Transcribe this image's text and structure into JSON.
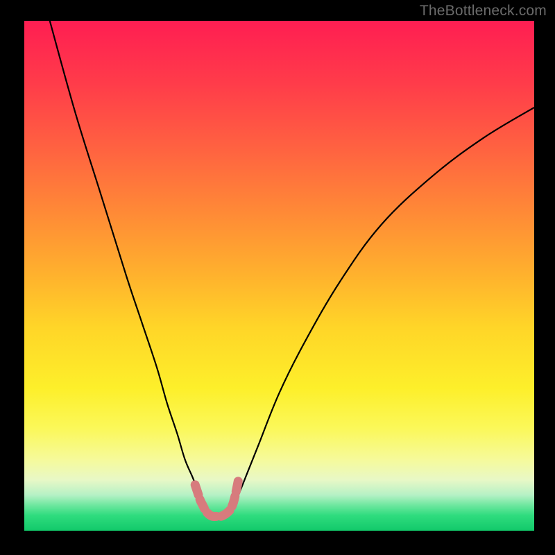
{
  "watermark": "TheBottleneck.com",
  "chart_data": {
    "type": "line",
    "title": "",
    "xlabel": "",
    "ylabel": "",
    "xlim": [
      0,
      100
    ],
    "ylim": [
      0,
      100
    ],
    "series": [
      {
        "name": "left-curve",
        "x": [
          5,
          10,
          15,
          20,
          23,
          26,
          28,
          30,
          31.5,
          33,
          34,
          35,
          36.5
        ],
        "values": [
          100,
          82,
          66,
          50,
          41,
          32,
          25,
          19,
          14,
          10.5,
          8,
          6,
          3.5
        ]
      },
      {
        "name": "right-curve",
        "x": [
          40.5,
          42,
          44,
          46,
          50,
          55,
          62,
          70,
          80,
          90,
          100
        ],
        "values": [
          3.5,
          7,
          12,
          17,
          27,
          37,
          49,
          60,
          69.5,
          77,
          83
        ]
      },
      {
        "name": "valley-marker",
        "x": [
          33.5,
          34,
          34.5,
          35,
          35.5,
          36,
          36.5,
          37,
          37.5,
          38,
          38.5,
          39,
          39.5,
          40,
          40.5,
          41,
          41.5,
          42
        ],
        "values": [
          9,
          7.5,
          6,
          5,
          4,
          3.4,
          3,
          2.8,
          2.8,
          2.8,
          2.8,
          3,
          3.3,
          3.7,
          4.3,
          5.5,
          7.5,
          10
        ]
      }
    ],
    "colors": {
      "curve": "#000000",
      "marker": "#d77b7d"
    }
  }
}
